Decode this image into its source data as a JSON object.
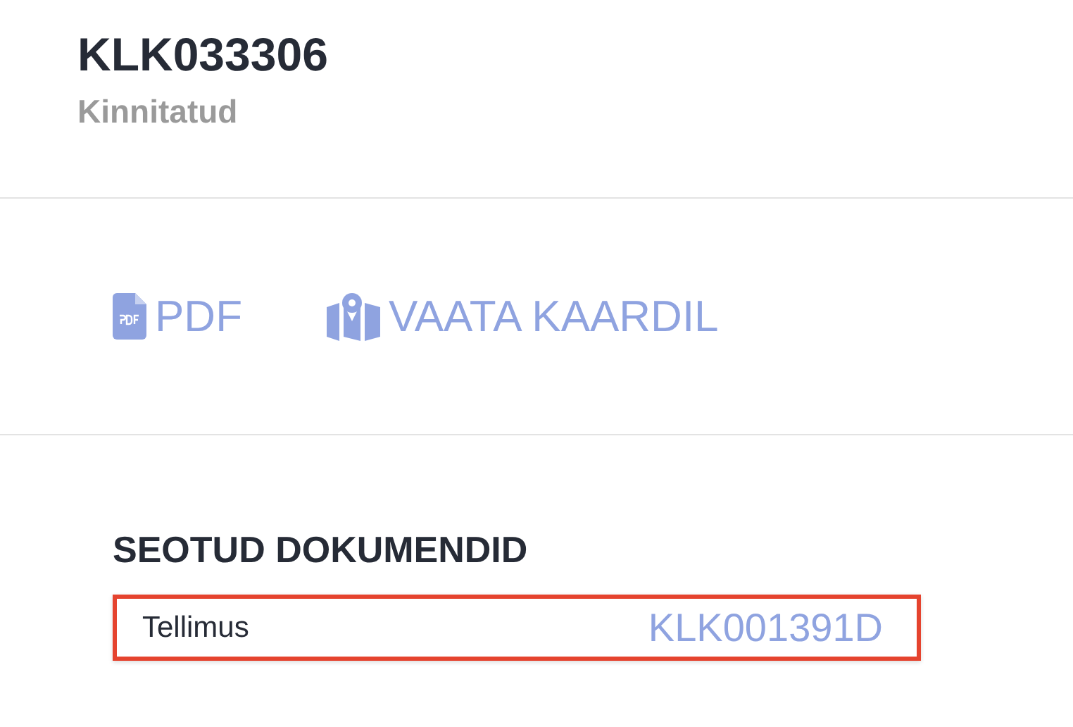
{
  "document": {
    "number": "KLK033306",
    "status": "Kinnitatud"
  },
  "actions": [
    {
      "kind": "pdf",
      "label": "PDF"
    },
    {
      "kind": "map",
      "label": "VAATA KAARDIL"
    }
  ],
  "related": {
    "heading": "SEOTUD DOKUMENDID",
    "rows": [
      {
        "label": "Tellimus",
        "link": "KLK001391D",
        "highlighted": true
      }
    ]
  }
}
